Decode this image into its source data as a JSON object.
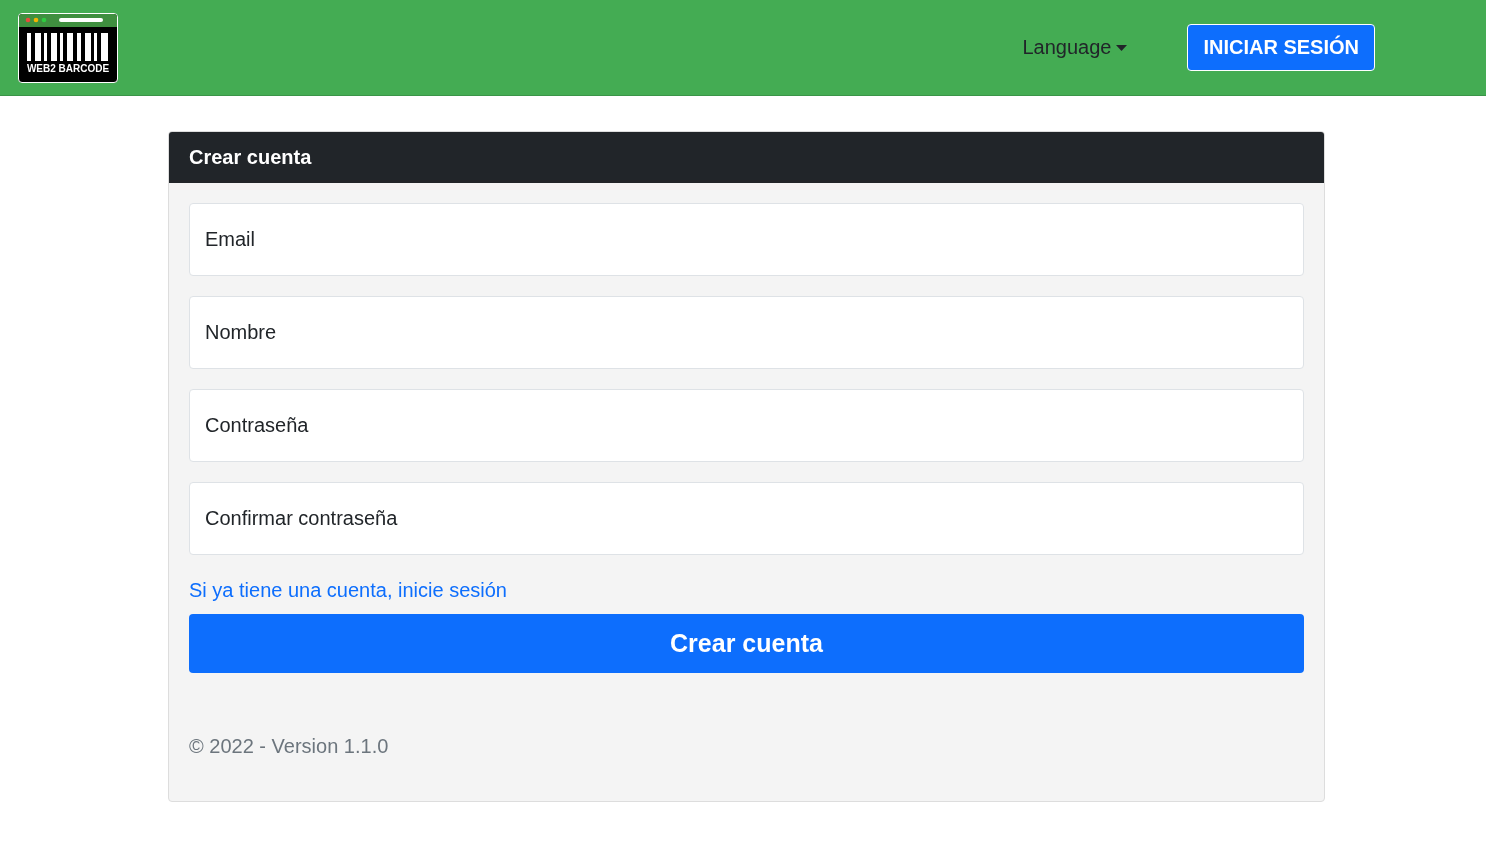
{
  "navbar": {
    "logo_text": "WEB2 BARCODE",
    "language": "Language",
    "login_button": "INICIAR SESIÓN"
  },
  "card": {
    "title": "Crear cuenta",
    "fields": [
      {
        "placeholder": "Email"
      },
      {
        "placeholder": "Nombre"
      },
      {
        "placeholder": "Contraseña"
      },
      {
        "placeholder": "Confirmar contraseña"
      }
    ],
    "login_link": "Si ya tiene una cuenta, inicie sesión",
    "submit_button": "Crear cuenta",
    "footer": "© 2022 - Version 1.1.0"
  }
}
